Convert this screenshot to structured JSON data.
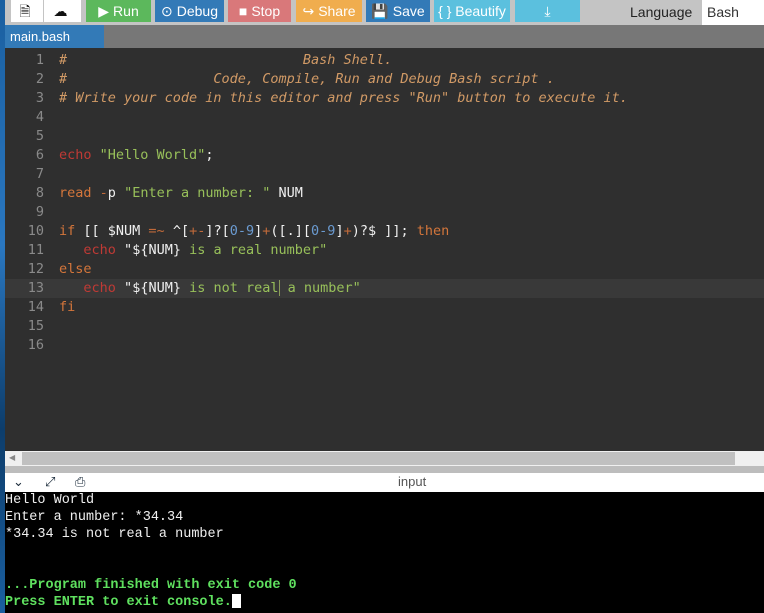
{
  "toolbar": {
    "new_file_icon": "file-icon",
    "upload_icon": "cloud-upload-icon",
    "run_label": "Run",
    "debug_label": "Debug",
    "stop_label": "Stop",
    "share_label": "Share",
    "save_label": "Save",
    "beautify_label": "{ } Beautify",
    "download_icon": "download-icon",
    "language_label": "Language",
    "language_value": "Bash"
  },
  "tabs": [
    {
      "label": "main.bash",
      "active": true
    }
  ],
  "editor": {
    "active_line": 13,
    "lines": [
      {
        "n": "1",
        "segments": [
          {
            "t": "#                             Bash Shell.",
            "c": "comment"
          }
        ]
      },
      {
        "n": "2",
        "segments": [
          {
            "t": "#                  Code, Compile, Run and Debug Bash script .",
            "c": "comment"
          }
        ]
      },
      {
        "n": "3",
        "segments": [
          {
            "t": "# Write your code in this editor and press \"Run\" button to execute it.",
            "c": "comment"
          }
        ]
      },
      {
        "n": "4",
        "segments": []
      },
      {
        "n": "5",
        "segments": []
      },
      {
        "n": "6",
        "segments": [
          {
            "t": "echo",
            "c": "cmd"
          },
          {
            "t": " ",
            "c": ""
          },
          {
            "t": "\"Hello World\"",
            "c": "str"
          },
          {
            "t": ";",
            "c": "var"
          }
        ]
      },
      {
        "n": "7",
        "segments": []
      },
      {
        "n": "8",
        "segments": [
          {
            "t": "read",
            "c": "kw"
          },
          {
            "t": " ",
            "c": ""
          },
          {
            "t": "-",
            "c": "op"
          },
          {
            "t": "p ",
            "c": "var"
          },
          {
            "t": "\"Enter a number: \"",
            "c": "str"
          },
          {
            "t": " NUM",
            "c": "var"
          }
        ]
      },
      {
        "n": "9",
        "segments": []
      },
      {
        "n": "10",
        "segments": [
          {
            "t": "if",
            "c": "kw"
          },
          {
            "t": " [[ $NUM ",
            "c": "var"
          },
          {
            "t": "=~",
            "c": "op"
          },
          {
            "t": " ^[",
            "c": "var"
          },
          {
            "t": "+-",
            "c": "op"
          },
          {
            "t": "]?[",
            "c": "var"
          },
          {
            "t": "0-9",
            "c": "num"
          },
          {
            "t": "]",
            "c": "var"
          },
          {
            "t": "+",
            "c": "op"
          },
          {
            "t": "([.][",
            "c": "var"
          },
          {
            "t": "0-9",
            "c": "num"
          },
          {
            "t": "]",
            "c": "var"
          },
          {
            "t": "+",
            "c": "op"
          },
          {
            "t": ")?$ ]]; ",
            "c": "var"
          },
          {
            "t": "then",
            "c": "kw"
          }
        ]
      },
      {
        "n": "11",
        "segments": [
          {
            "t": "   ",
            "c": ""
          },
          {
            "t": "echo",
            "c": "cmd"
          },
          {
            "t": " ",
            "c": ""
          },
          {
            "t": "\"",
            "c": "var"
          },
          {
            "t": "${NUM}",
            "c": "var"
          },
          {
            "t": " is a real number\"",
            "c": "str"
          }
        ]
      },
      {
        "n": "12",
        "segments": [
          {
            "t": "else",
            "c": "kw"
          }
        ]
      },
      {
        "n": "13",
        "segments": [
          {
            "t": "   ",
            "c": ""
          },
          {
            "t": "echo",
            "c": "cmd"
          },
          {
            "t": " ",
            "c": ""
          },
          {
            "t": "\"",
            "c": "var"
          },
          {
            "t": "${NUM}",
            "c": "var"
          },
          {
            "t": " is not real",
            "c": "str"
          },
          {
            "t": "|CURSOR|",
            "c": "cursor"
          },
          {
            "t": " a number\"",
            "c": "str"
          }
        ]
      },
      {
        "n": "14",
        "segments": [
          {
            "t": "fi",
            "c": "kw"
          }
        ]
      },
      {
        "n": "15",
        "segments": []
      },
      {
        "n": "16",
        "segments": []
      }
    ]
  },
  "io_panel": {
    "collapse_icon": "chevron-down-icon",
    "expand_icon": "expand-arrows-icon",
    "stdin_icon": "stdin-file-icon",
    "title": "input"
  },
  "console": {
    "lines": [
      {
        "text": "Hello World",
        "style": "normal"
      },
      {
        "text": "Enter a number: *34.34",
        "style": "normal"
      },
      {
        "text": "*34.34 is not real a number",
        "style": "normal"
      },
      {
        "text": "",
        "style": "normal"
      },
      {
        "text": "",
        "style": "normal"
      },
      {
        "text": "...Program finished with exit code 0",
        "style": "green"
      },
      {
        "text": "Press ENTER to exit console.",
        "style": "green",
        "cursor": true
      }
    ]
  }
}
